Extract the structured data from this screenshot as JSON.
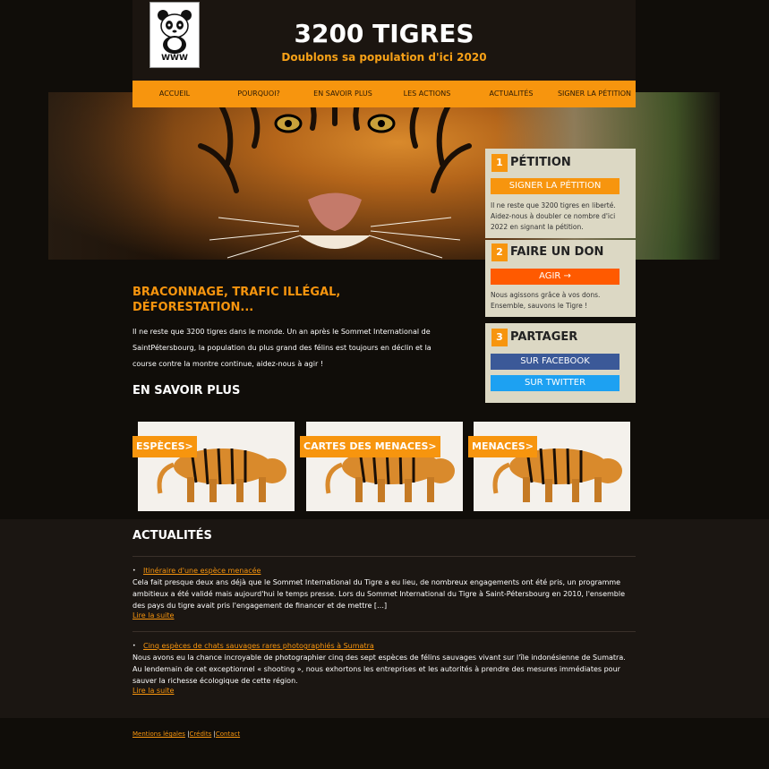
{
  "header": {
    "logo_text": "WWW",
    "title": "3200 TIGRES",
    "subtitle": "Doublons sa population d'ici 2020"
  },
  "nav": [
    "ACCUEIL",
    "POURQUOI?",
    "EN SAVOIR PLUS",
    "LES ACTIONS",
    "ACTUALITÉS",
    "SIGNER LA PÉTITION"
  ],
  "sidebar": {
    "petition": {
      "num": "1",
      "title": "PÉTITION",
      "button": "SIGNER LA PÉTITION",
      "text": "Il ne reste que 3200 tigres en liberté. Aidez-nous à doubler ce nombre d'ici 2022 en signant la pétition."
    },
    "donate": {
      "num": "2",
      "title": "FAIRE UN DON",
      "button": "AGIR →",
      "text": "Nous agissons grâce à vos dons. Ensemble, sauvons le Tigre !"
    },
    "share": {
      "num": "3",
      "title": "PARTAGER",
      "facebook": "SUR FACEBOOK",
      "twitter": "SUR TWITTER"
    }
  },
  "main": {
    "heading": "BRACONNAGE, TRAFIC ILLÉGAL, DÉFORESTATION...",
    "text": "Il ne reste que 3200 tigres dans le monde. Un an après le Sommet International de SaintPétersbourg, la population du plus grand des félins est toujours en déclin et la course contre la montre continue, aidez-nous à agir !",
    "more_heading": "EN SAVOIR PLUS",
    "cards": [
      "ESPÈCES>",
      "CARTES DES MENACES>",
      "MENACES>"
    ]
  },
  "news": {
    "heading": "ACTUALITÉS",
    "items": [
      {
        "title": "Itinéraire d'une espèce menacée",
        "body": "Cela fait presque deux ans déjà que le Sommet International du Tigre a eu lieu, de nombreux engagements ont été pris, un programme ambitieux a été validé mais aujourd'hui le temps presse. Lors du Sommet International du Tigre à Saint-Pétersbourg en 2010, l'ensemble des pays du tigre avait pris l'engagement de financer et de mettre […]",
        "more": "Lire la suite"
      },
      {
        "title": "Cinq espèces de chats sauvages rares photographiés à Sumatra",
        "body": "Nous avons eu la chance incroyable de photographier cinq des sept espèces de félins sauvages vivant sur l'île indonésienne de Sumatra. Au lendemain de cet exceptionnel « shooting », nous exhortons les entreprises et les autorités à prendre des mesures immédiates pour sauver la richesse écologique de cette région.",
        "more": "Lire la suite"
      }
    ]
  },
  "footer": {
    "links": [
      "Mentions légales",
      "Crédits",
      "Contact"
    ],
    "separator": "|"
  },
  "colors": {
    "accent": "#f7950e",
    "background": "#100d09",
    "sidebar": "#dcd8c4",
    "facebook": "#3b5998",
    "twitter": "#1da1f2",
    "cta": "#ff5a00"
  },
  "icons": {
    "logo": "panda-icon",
    "arrow": "arrow-right-icon"
  }
}
